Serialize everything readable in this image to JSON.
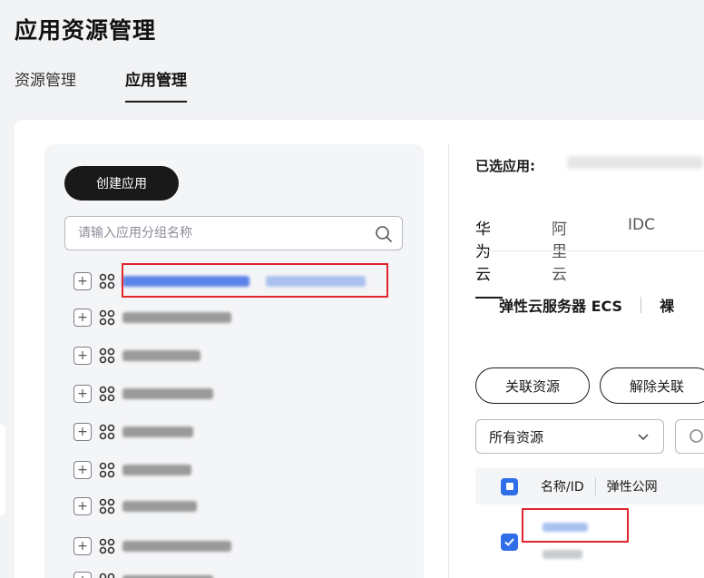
{
  "page_title": "应用资源管理",
  "tabs": [
    {
      "label": "资源管理",
      "active": false
    },
    {
      "label": "应用管理",
      "active": true
    }
  ],
  "left": {
    "create_button": "创建应用",
    "search_placeholder": "请输入应用分组名称",
    "tree_expand_symbol": "+"
  },
  "right": {
    "selected_label": "已选应用:",
    "cloud_tabs": [
      {
        "label": "华为云",
        "active": true
      },
      {
        "label": "阿里云",
        "active": false
      },
      {
        "label": "IDC",
        "active": false
      }
    ],
    "service_tab": "弹性云服务器 ECS",
    "service_tab_next": "裸",
    "associate_button": "关联资源",
    "disassociate_button": "解除关联",
    "resource_filter": "所有资源",
    "table": {
      "col_name": "名称/ID",
      "col_eip": "弹性公网"
    }
  },
  "colors": {
    "accent_blue": "#2f6ee8",
    "highlight_red": "#e0262c",
    "primary_dark": "#191919"
  }
}
